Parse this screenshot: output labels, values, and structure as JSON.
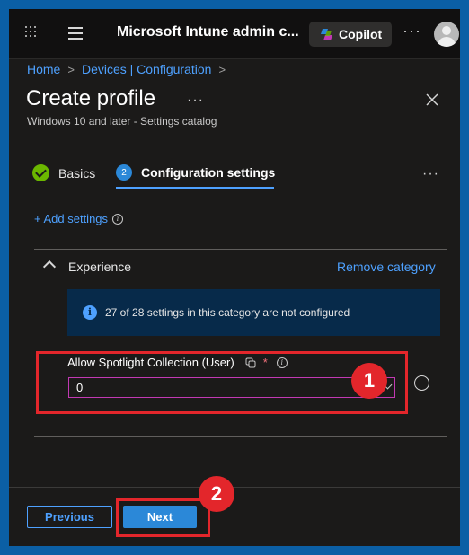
{
  "topbar": {
    "app_title": "Microsoft Intune admin c...",
    "copilot_label": "Copilot",
    "more": "···",
    "icons": [
      "waffle-icon",
      "hamburger-icon",
      "copilot-icon",
      "more-icon",
      "avatar"
    ]
  },
  "breadcrumb": {
    "items": [
      "Home",
      "Devices | Configuration"
    ],
    "separator": ">"
  },
  "page": {
    "title": "Create profile",
    "title_more": "···",
    "subtitle": "Windows 10 and later - Settings catalog"
  },
  "wizard": {
    "steps": [
      {
        "label": "Basics",
        "status": "complete"
      },
      {
        "number": "2",
        "label": "Configuration settings",
        "status": "active"
      }
    ],
    "more": "···"
  },
  "settings": {
    "add_label": "+ Add settings",
    "category": {
      "name": "Experience",
      "remove_label": "Remove category",
      "info_banner": "27 of 28 settings in this category are not configured",
      "setting": {
        "label": "Allow Spotlight Collection (User)",
        "required_marker": "*",
        "value": "0"
      }
    }
  },
  "annotations": {
    "badge_1": "1",
    "badge_2": "2",
    "color": "#e3262b"
  },
  "footer": {
    "previous_label": "Previous",
    "next_label": "Next"
  },
  "colors": {
    "accent": "#4ea1ff",
    "primary_button": "#2b88d8",
    "success": "#6bb700",
    "background": "#1b1a19",
    "border_frame": "#0b5fa5"
  }
}
